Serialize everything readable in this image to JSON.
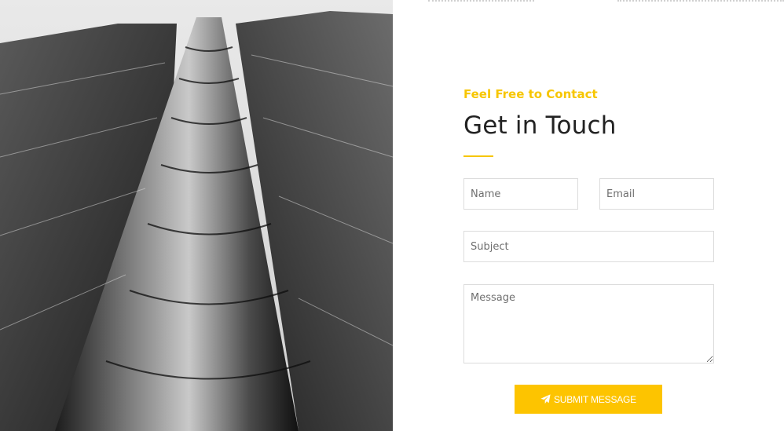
{
  "contact": {
    "eyebrow": "Feel Free to Contact",
    "heading": "Get in Touch",
    "accent_color": "#f7c600",
    "fields": {
      "name_placeholder": "Name",
      "email_placeholder": "Email",
      "subject_placeholder": "Subject",
      "message_placeholder": "Message"
    },
    "submit_label": "SUBMIT MESSAGE",
    "submit_icon": "paper-plane-icon"
  },
  "photo": {
    "subject": "building-photo"
  }
}
